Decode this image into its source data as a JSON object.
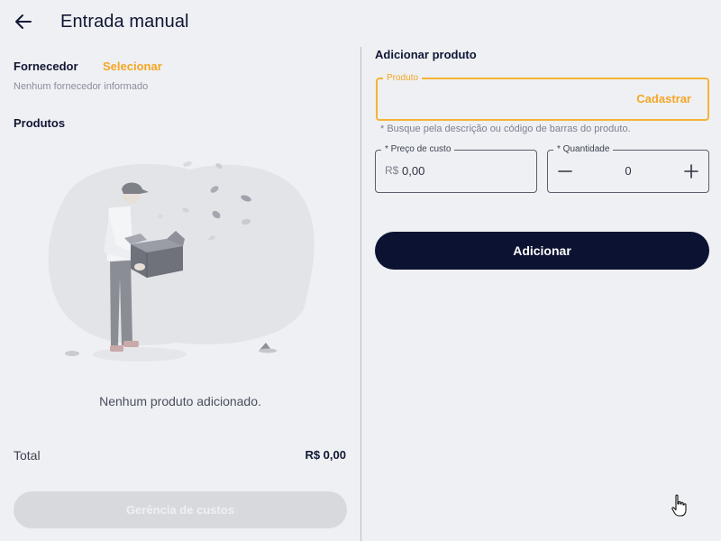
{
  "header": {
    "title": "Entrada manual",
    "back_icon": "arrow-left-icon"
  },
  "supplier": {
    "label": "Fornecedor",
    "select_label": "Selecionar",
    "empty_text": "Nenhum fornecedor informado"
  },
  "products": {
    "label": "Produtos",
    "empty_text": "Nenhum produto adicionado.",
    "illustration_icon": "delivery-person-with-box-icon"
  },
  "totals": {
    "label": "Total",
    "value": "R$ 0,00"
  },
  "cost_management_button": {
    "label": "Gerência de custos",
    "enabled": false
  },
  "add_product": {
    "title": "Adicionar produto",
    "product_field": {
      "legend": "Produto",
      "value": "",
      "action_label": "Cadastrar"
    },
    "product_hint": "* Busque pela descrição ou código de barras do produto.",
    "price_field": {
      "legend": "* Preço de custo",
      "currency": "R$",
      "value": "0,00"
    },
    "quantity_field": {
      "legend": "* Quantidade",
      "value": "0",
      "minus_icon": "minus-icon",
      "plus_icon": "plus-icon"
    },
    "submit_label": "Adicionar"
  },
  "colors": {
    "accent": "#f5a623",
    "primary": "#0b1232",
    "background": "#eef0f3",
    "disabled": "#d7d9dd"
  }
}
